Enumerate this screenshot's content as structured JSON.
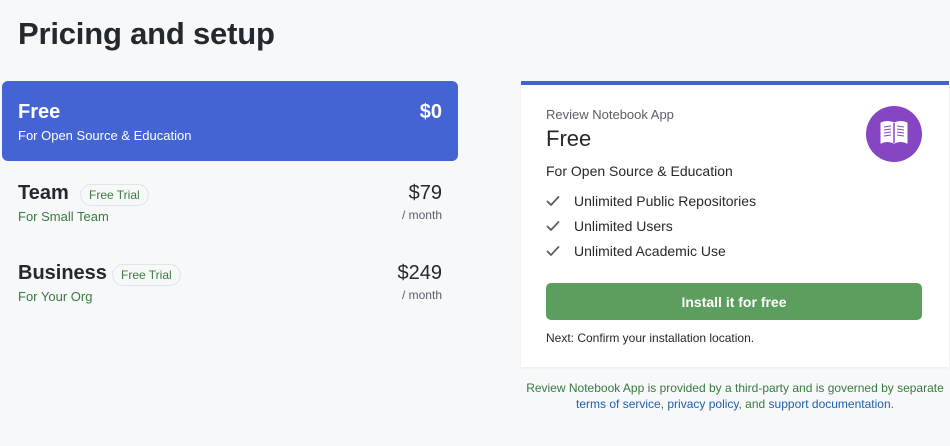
{
  "page": {
    "title": "Pricing and setup"
  },
  "plans": [
    {
      "name": "Free",
      "description": "For Open Source & Education",
      "price": "$0",
      "period": "",
      "badge": "",
      "selected": true
    },
    {
      "name": "Team",
      "description": "For Small Team",
      "price": "$79",
      "period": "/ month",
      "badge": "Free Trial",
      "selected": false
    },
    {
      "name": "Business",
      "description": "For Your Org",
      "price": "$249",
      "period": "/ month",
      "badge": "Free Trial",
      "selected": false
    }
  ],
  "card": {
    "app_name": "Review Notebook App",
    "plan_name": "Free",
    "plan_description": "For Open Source & Education",
    "logo_icon": "book-icon",
    "features": [
      {
        "icon": "check-icon",
        "label": "Unlimited Public Repositories"
      },
      {
        "icon": "check-icon",
        "label": "Unlimited Users"
      },
      {
        "icon": "check-icon",
        "label": "Unlimited Academic Use"
      }
    ],
    "install_button_label": "Install it for free",
    "next_note": "Next: Confirm your installation location."
  },
  "footer": {
    "text_before": "Review Notebook App is provided by a third-party and is governed by separate ",
    "terms_link": "terms of service",
    "comma": ", ",
    "privacy_link": "privacy policy",
    "and_text": ", and ",
    "support_link": "support documentation",
    "period": "."
  },
  "colors": {
    "accent": "#4464d3",
    "install_button": "#5b9e5e",
    "logo_bg": "#8646c4",
    "badge_text": "#3a7a3f",
    "link": "#1f5fad"
  }
}
